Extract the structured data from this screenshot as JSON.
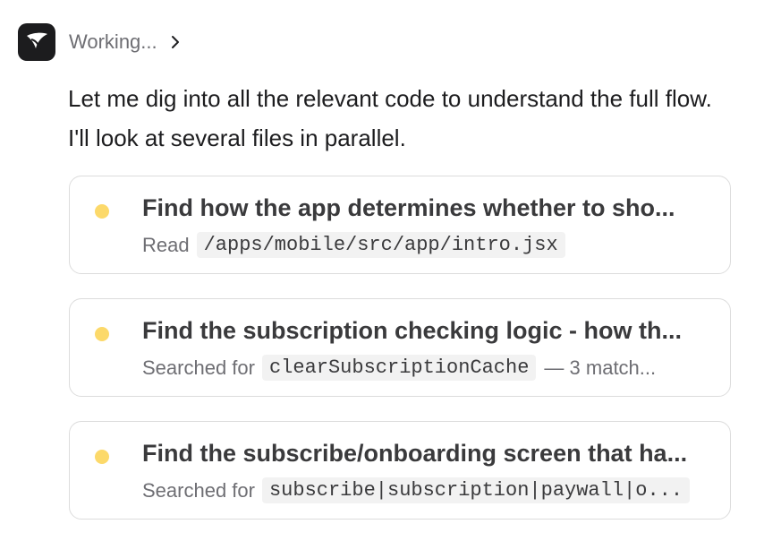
{
  "header": {
    "avatar_icon": "app-logo-icon",
    "status_text": "Working..."
  },
  "message": "Let me dig into all the relevant code to understand the full flow. I'll look at several files in parallel.",
  "tasks": [
    {
      "title": "Find how the app determines whether to sho...",
      "action": "Read",
      "code": "/apps/mobile/src/app/intro.jsx",
      "suffix": "",
      "status_color": "#fcd96a"
    },
    {
      "title": "Find the subscription checking logic - how th...",
      "action": "Searched for",
      "code": "clearSubscriptionCache",
      "suffix": "— 3 match...",
      "status_color": "#fcd96a"
    },
    {
      "title": "Find the subscribe/onboarding screen that ha...",
      "action": "Searched for",
      "code": "subscribe|subscription|paywall|o...",
      "suffix": "",
      "status_color": "#fcd96a"
    }
  ]
}
